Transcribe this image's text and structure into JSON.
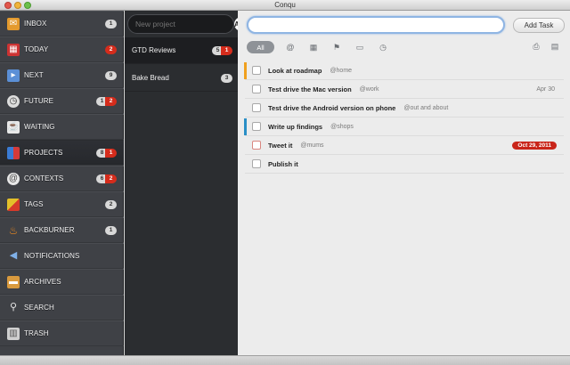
{
  "window": {
    "title": "Conqu"
  },
  "sidebar": {
    "items": [
      {
        "label": "INBOX",
        "icon": "inbox-icon",
        "badges": [
          {
            "value": "1",
            "color": "gray"
          }
        ]
      },
      {
        "label": "TODAY",
        "icon": "calendar-icon",
        "badges": [
          {
            "value": "2",
            "color": "red"
          }
        ]
      },
      {
        "label": "NEXT",
        "icon": "next-icon",
        "badges": [
          {
            "value": "9",
            "color": "gray"
          }
        ]
      },
      {
        "label": "FUTURE",
        "icon": "clock-icon",
        "badges": [
          {
            "value": "1",
            "color": "gray"
          },
          {
            "value": "2",
            "color": "red"
          }
        ]
      },
      {
        "label": "WAITING",
        "icon": "cup-icon",
        "badges": []
      },
      {
        "label": "PROJECTS",
        "icon": "projects-icon",
        "selected": true,
        "badges": [
          {
            "value": "8",
            "color": "gray"
          },
          {
            "value": "1",
            "color": "red"
          }
        ]
      },
      {
        "label": "CONTEXTS",
        "icon": "at-icon",
        "badges": [
          {
            "value": "6",
            "color": "gray"
          },
          {
            "value": "2",
            "color": "red"
          }
        ]
      },
      {
        "label": "TAGS",
        "icon": "tag-icon",
        "badges": [
          {
            "value": "2",
            "color": "gray"
          }
        ]
      },
      {
        "label": "BACKBURNER",
        "icon": "flame-icon",
        "badges": [
          {
            "value": "1",
            "color": "gray"
          }
        ]
      },
      {
        "label": "NOTIFICATIONS",
        "icon": "megaphone-icon",
        "badges": []
      },
      {
        "label": "ARCHIVES",
        "icon": "archive-box-icon",
        "badges": []
      },
      {
        "label": "SEARCH",
        "icon": "magnifier-icon",
        "badges": []
      },
      {
        "label": "TRASH",
        "icon": "trash-icon",
        "badges": []
      }
    ]
  },
  "projects_panel": {
    "new_project_placeholder": "New project",
    "add_label": "Add",
    "items": [
      {
        "name": "GTD Reviews",
        "selected": true,
        "badges": [
          {
            "value": "5",
            "color": "gray"
          },
          {
            "value": "1",
            "color": "red"
          }
        ]
      },
      {
        "name": "Bake Bread",
        "selected": false,
        "badges": [
          {
            "value": "3",
            "color": "gray"
          }
        ]
      }
    ]
  },
  "main": {
    "task_input_value": "",
    "add_task_label": "Add Task",
    "filters": {
      "all_label": "All",
      "icons": [
        "at-filter-icon",
        "calendar-filter-icon",
        "flag-filter-icon",
        "battery-filter-icon",
        "clock-filter-icon"
      ]
    },
    "view_icons": [
      "print-icon",
      "columns-view-icon"
    ],
    "tasks": [
      {
        "title": "Look at roadmap",
        "context": "@home",
        "date": "",
        "priority_color": "#f0a01e",
        "overdue": false,
        "checkbox_red": false
      },
      {
        "title": "Test drive the Mac version",
        "context": "@work",
        "date": "Apr 30",
        "priority_color": "",
        "overdue": false,
        "checkbox_red": false
      },
      {
        "title": "Test drive the Android version on phone",
        "context": "@out and about",
        "date": "",
        "priority_color": "",
        "overdue": false,
        "checkbox_red": false
      },
      {
        "title": "Write up findings",
        "context": "@shops",
        "date": "",
        "priority_color": "#2a8fc6",
        "overdue": false,
        "checkbox_red": false
      },
      {
        "title": "Tweet it",
        "context": "@mums",
        "date": "Oct 29, 2011",
        "priority_color": "",
        "overdue": true,
        "checkbox_red": true
      },
      {
        "title": "Publish it",
        "context": "",
        "date": "",
        "priority_color": "",
        "overdue": false,
        "checkbox_red": false
      }
    ]
  },
  "colors": {
    "badge_red": "#d52c1c",
    "badge_gray": "#d8d8d8",
    "accent_blue": "#8fb5e3"
  }
}
